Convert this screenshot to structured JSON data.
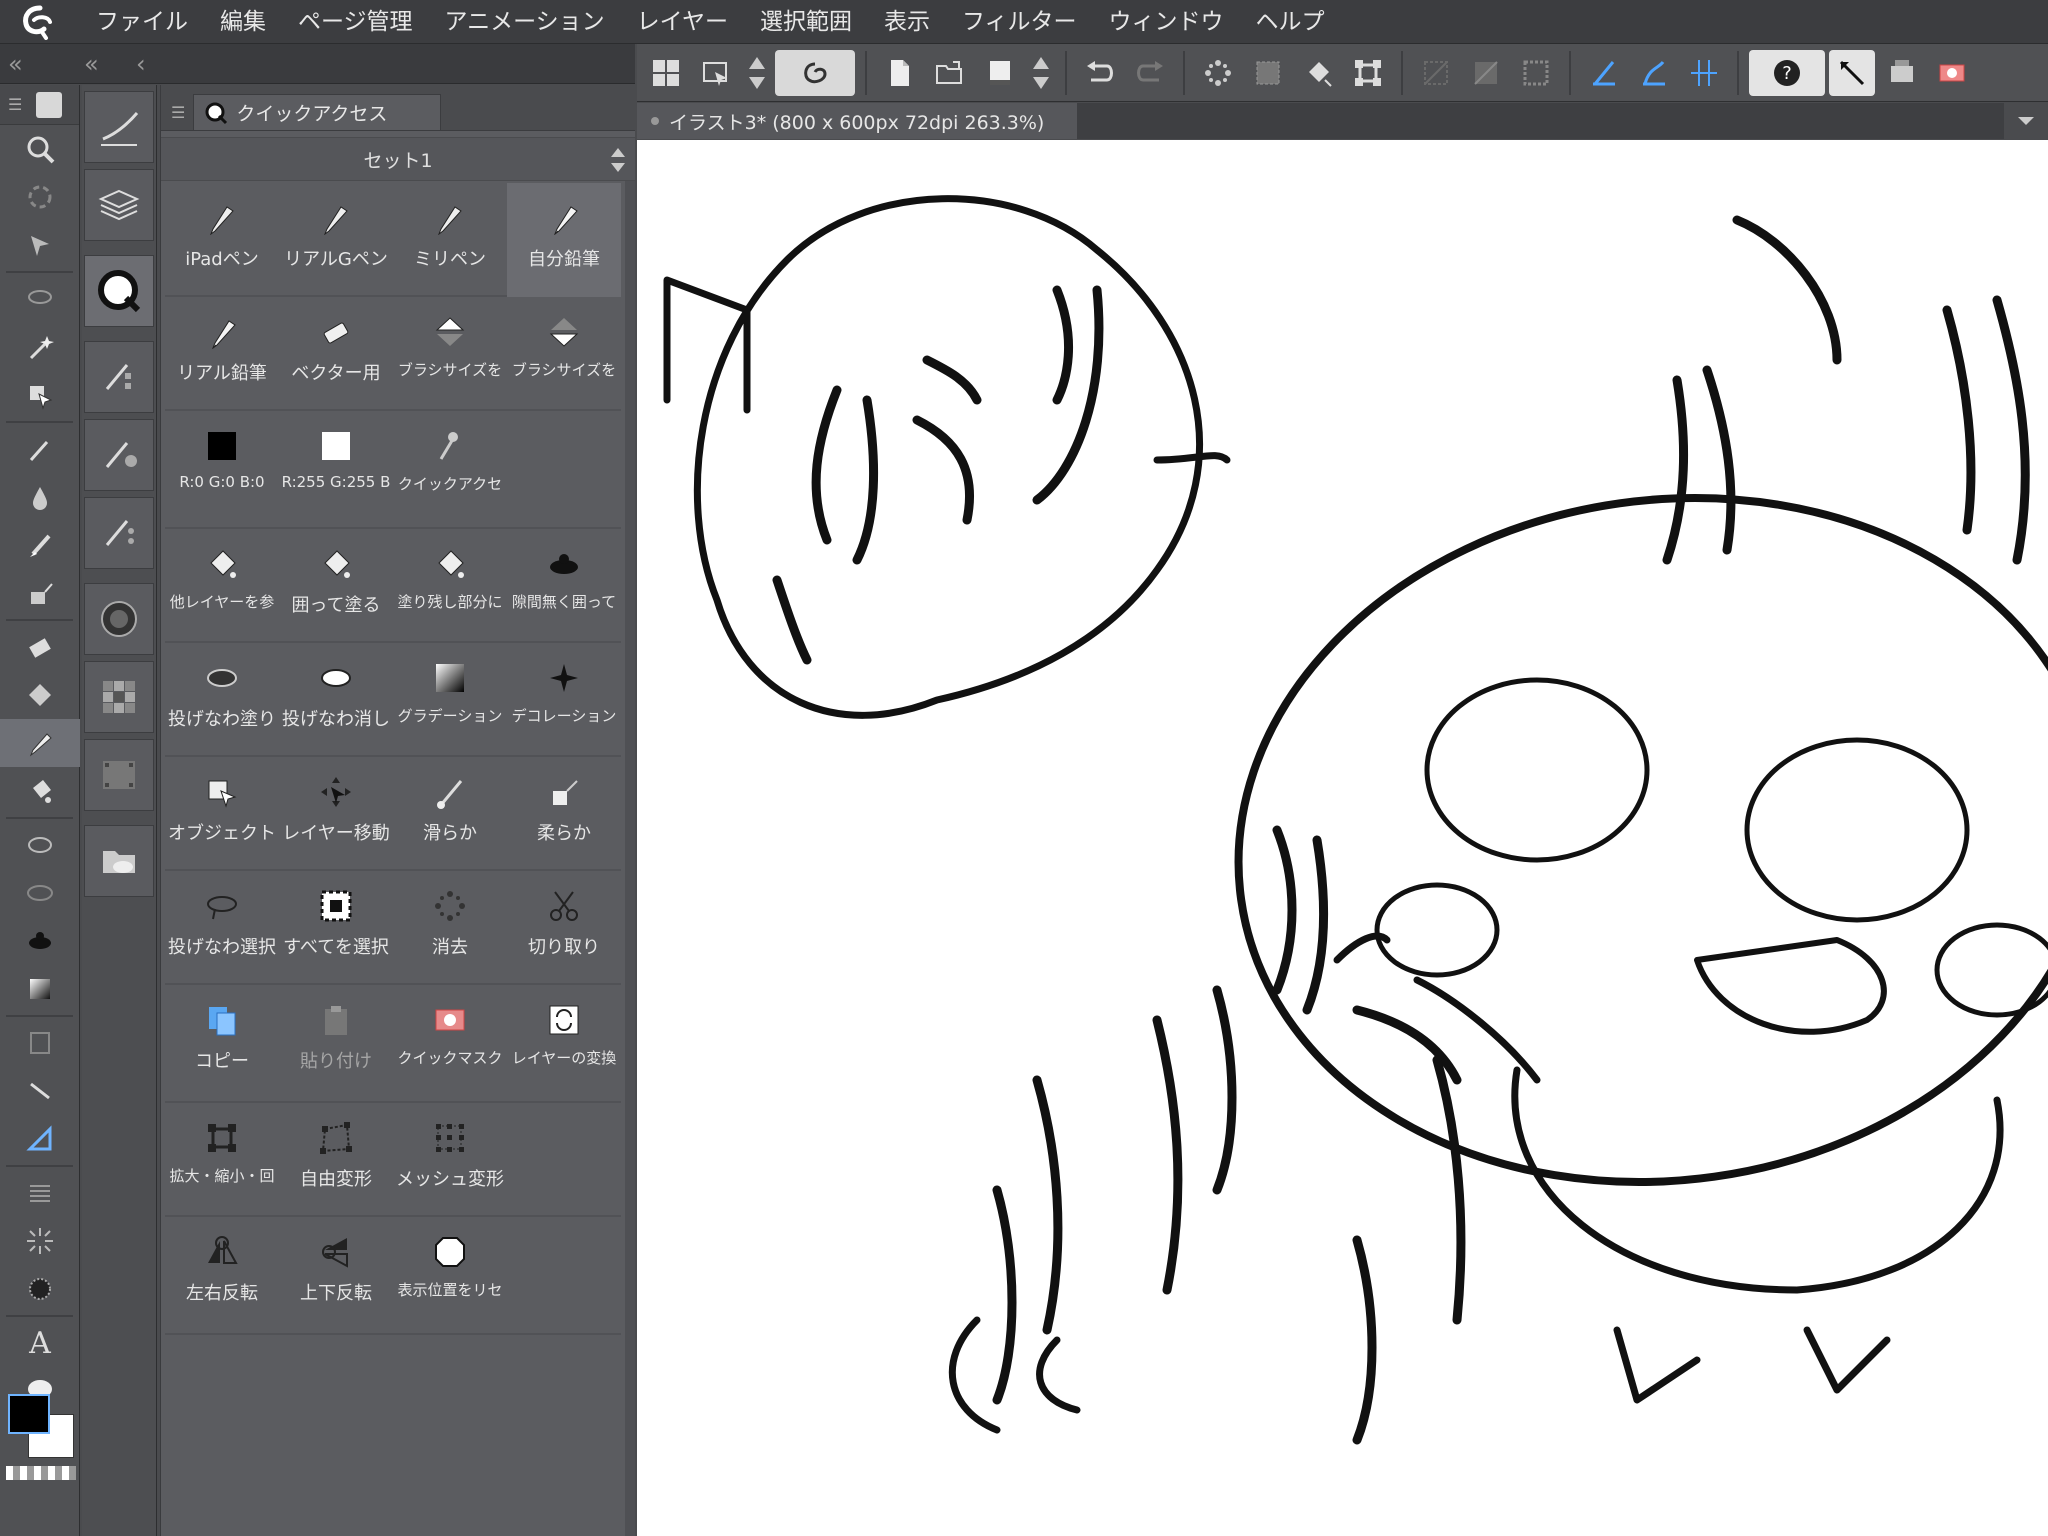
{
  "menubar": {
    "items": [
      "ファイル",
      "編集",
      "ページ管理",
      "アニメーション",
      "レイヤー",
      "選択範囲",
      "表示",
      "フィルター",
      "ウィンドウ",
      "ヘルプ"
    ]
  },
  "quick_access": {
    "tab_label": "クイックアクセス",
    "set_label": "セット1",
    "items": [
      {
        "label": "iPadペン",
        "icon": "pen-icon"
      },
      {
        "label": "リアルGペン",
        "icon": "pen-icon"
      },
      {
        "label": "ミリペン",
        "icon": "pen-icon"
      },
      {
        "label": "自分鉛筆",
        "icon": "pencil-icon"
      },
      {
        "label": "リアル鉛筆",
        "icon": "pencil-icon"
      },
      {
        "label": "ベクター用",
        "icon": "eraser-icon"
      },
      {
        "label": "ブラシサイズを",
        "icon": "size-up-icon"
      },
      {
        "label": "ブラシサイズを",
        "icon": "size-down-icon"
      },
      {
        "label": "R:0 G:0 B:0",
        "icon": "black-swatch-icon"
      },
      {
        "label": "R:255 G:255 B",
        "icon": "white-swatch-icon"
      },
      {
        "label": "クイックアクセ",
        "icon": "dropper-icon"
      },
      {
        "label": "",
        "icon": ""
      },
      {
        "label": "他レイヤーを参",
        "icon": "fill-icon"
      },
      {
        "label": "囲って塗る",
        "icon": "fill-icon"
      },
      {
        "label": "塗り残し部分に",
        "icon": "fill-icon"
      },
      {
        "label": "隙間無く囲って",
        "icon": "blob-icon"
      },
      {
        "label": "投げなわ塗り",
        "icon": "lasso-fill-icon"
      },
      {
        "label": "投げなわ消し",
        "icon": "lasso-erase-icon"
      },
      {
        "label": "グラデーション",
        "icon": "gradient-icon"
      },
      {
        "label": "デコレーション",
        "icon": "sparkle-icon"
      },
      {
        "label": "オブジェクト",
        "icon": "object-icon"
      },
      {
        "label": "レイヤー移動",
        "icon": "move-icon"
      },
      {
        "label": "滑らか",
        "icon": "blend-icon"
      },
      {
        "label": "柔らか",
        "icon": "airbrush-icon"
      },
      {
        "label": "投げなわ選択",
        "icon": "lasso-select-icon"
      },
      {
        "label": "すべてを選択",
        "icon": "select-all-icon"
      },
      {
        "label": "消去",
        "icon": "clear-icon"
      },
      {
        "label": "切り取り",
        "icon": "scissors-icon"
      },
      {
        "label": "コピー",
        "icon": "copy-icon"
      },
      {
        "label": "貼り付け",
        "icon": "paste-icon",
        "disabled": true
      },
      {
        "label": "クイックマスク",
        "icon": "quickmask-icon"
      },
      {
        "label": "レイヤーの変換",
        "icon": "convert-icon"
      },
      {
        "label": "拡大・縮小・回",
        "icon": "scale-icon"
      },
      {
        "label": "自由変形",
        "icon": "free-transform-icon"
      },
      {
        "label": "メッシュ変形",
        "icon": "mesh-icon"
      },
      {
        "label": "",
        "icon": ""
      },
      {
        "label": "左右反転",
        "icon": "flip-h-icon"
      },
      {
        "label": "上下反転",
        "icon": "flip-v-icon"
      },
      {
        "label": "表示位置をリセ",
        "icon": "reset-view-icon"
      },
      {
        "label": "",
        "icon": ""
      }
    ]
  },
  "document": {
    "tab_title": "イラスト3* (800 x 600px 72dpi 263.3%)"
  },
  "colors": {
    "main": "#000000",
    "sub": "#ffffff",
    "accent": "#3a8ee6"
  }
}
